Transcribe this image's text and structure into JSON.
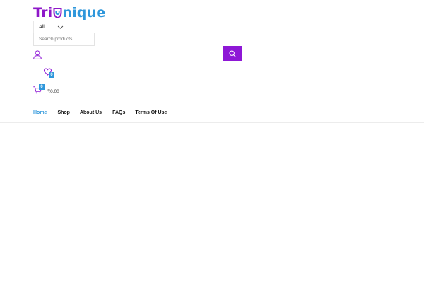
{
  "header": {
    "logo": {
      "part1": "Tri",
      "part2": "nique",
      "mark_icon": "u-shield-icon"
    },
    "category_select": {
      "selected": "All",
      "icon": "chevron-down-icon"
    },
    "search": {
      "placeholder": "Search products...",
      "value": "",
      "button_icon": "search-icon"
    },
    "account": {
      "icon": "user-icon"
    },
    "wishlist": {
      "icon": "heart-icon",
      "count": "0"
    },
    "cart": {
      "icon": "cart-icon",
      "count": "0",
      "total": "₹0.00"
    }
  },
  "nav": {
    "items": [
      {
        "label": "Home",
        "active": true
      },
      {
        "label": "Shop",
        "active": false
      },
      {
        "label": "About Us",
        "active": false
      },
      {
        "label": "FAQs",
        "active": false
      },
      {
        "label": "Terms Of Use",
        "active": false
      }
    ]
  },
  "colors": {
    "brand_purple": "#8e17d6",
    "brand_blue": "#2f97db"
  }
}
